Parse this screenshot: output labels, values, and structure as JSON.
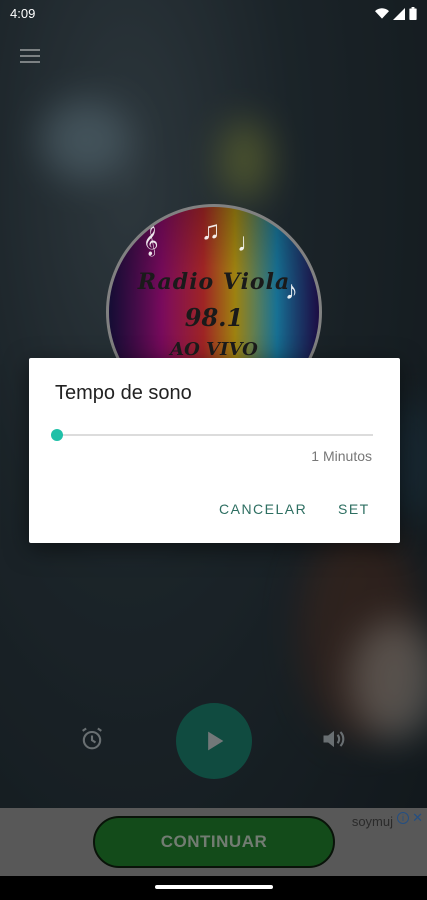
{
  "status_bar": {
    "time": "4:09"
  },
  "station": {
    "art_name": "Radio Viola",
    "art_frequency": "98.1",
    "art_live": "AO VIVO"
  },
  "player": {
    "alarm_icon": "alarm-icon",
    "play_icon": "play-icon",
    "volume_icon": "volume-icon",
    "accent": "#1a7a68"
  },
  "dialog": {
    "title": "Tempo de sono",
    "slider_fraction": 0.0,
    "slider_value": "1 Minutos",
    "cancel_label": "CANCELAR",
    "set_label": "SET",
    "accent": "#1fc0a8"
  },
  "ad": {
    "brand": "soymuj",
    "cta_label": "CONTINUAR",
    "info_icon": "info-icon",
    "close_icon": "close-icon"
  }
}
